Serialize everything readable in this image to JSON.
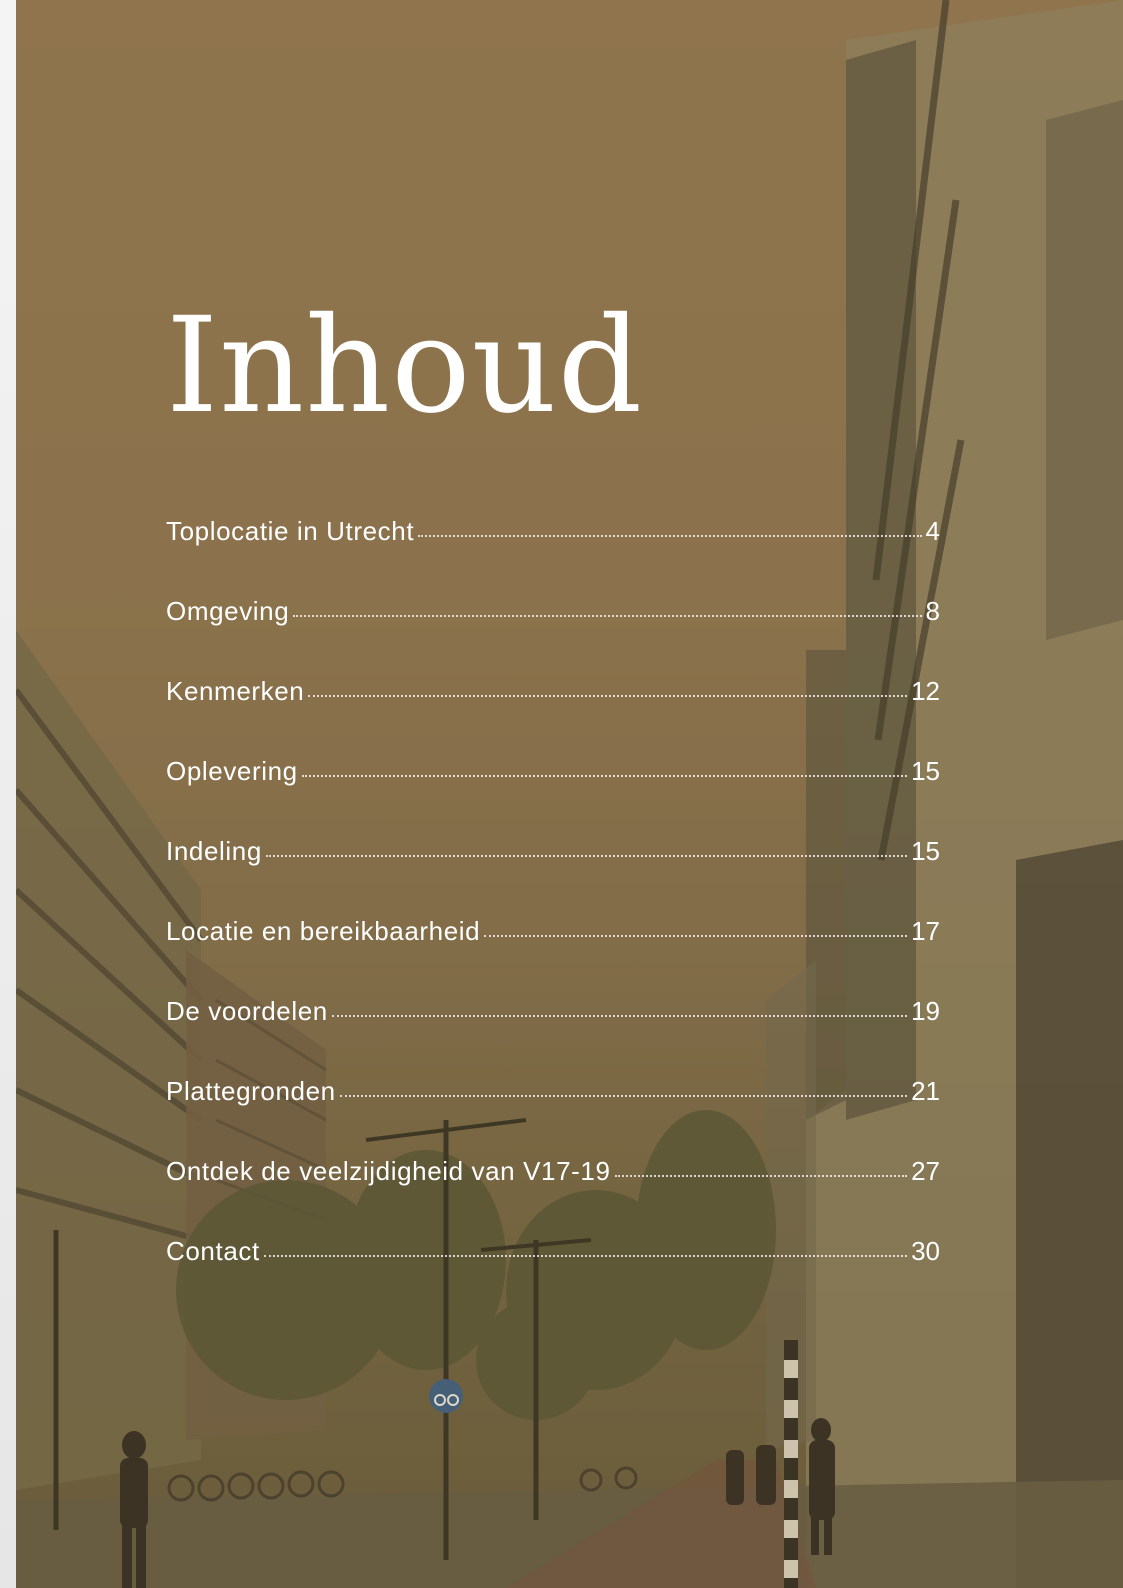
{
  "page": {
    "title": "Inhoud",
    "overlay_color": "#8d744f"
  },
  "toc": {
    "items": [
      {
        "label": "Toplocatie in Utrecht",
        "page": "4"
      },
      {
        "label": "Omgeving",
        "page": "8"
      },
      {
        "label": "Kenmerken",
        "page": "12"
      },
      {
        "label": "Oplevering",
        "page": "15"
      },
      {
        "label": "Indeling",
        "page": "15"
      },
      {
        "label": "Locatie en bereikbaarheid",
        "page": "17"
      },
      {
        "label": "De voordelen",
        "page": "19"
      },
      {
        "label": "Plattegronden",
        "page": "21"
      },
      {
        "label": "Ontdek de veelzijdigheid van V17-19",
        "page": "27"
      },
      {
        "label": "Contact",
        "page": "30"
      }
    ]
  },
  "background": {
    "description_icon": "street-photo-icon"
  }
}
